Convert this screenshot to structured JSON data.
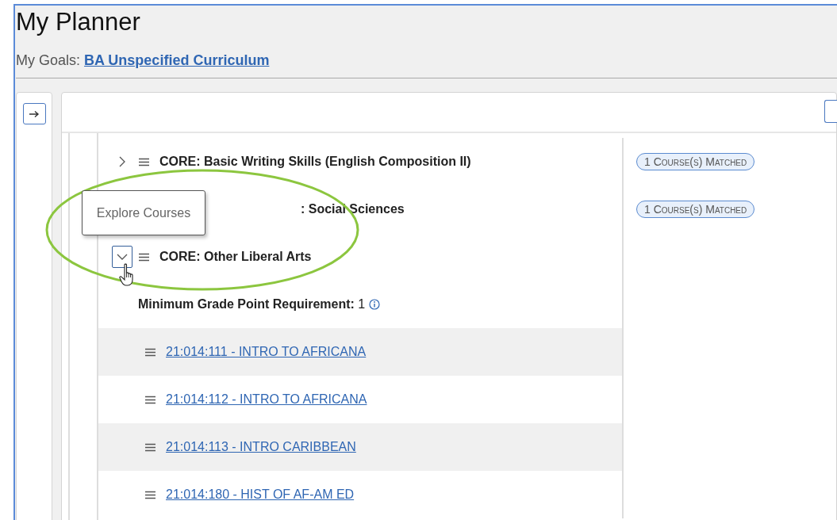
{
  "page": {
    "title": "My Planner",
    "goals_label": "My Goals:",
    "goal_link": "BA Unspecified Curriculum"
  },
  "requirements": [
    {
      "title": "CORE: Basic Writing Skills (English Composition II)",
      "expanded": false,
      "badge": "1 Course(s) Matched"
    },
    {
      "title": ": Social Sciences",
      "badge": "1 Course(s) Matched"
    },
    {
      "title": "CORE: Other Liberal Arts",
      "expanded": true
    }
  ],
  "gpa_requirement": "**Minimum Grade Point Requirement:** 1",
  "courses": [
    {
      "title": "21:014:111 - INTRO TO AFRICANA"
    },
    {
      "title": "21:014:112 - INTRO TO AFRICANA"
    },
    {
      "title": "21:014:113 - INTRO CARIBBEAN"
    },
    {
      "title": "21:014:180 - HIST OF AF-AM ED"
    }
  ],
  "tooltip": "Explore Courses"
}
